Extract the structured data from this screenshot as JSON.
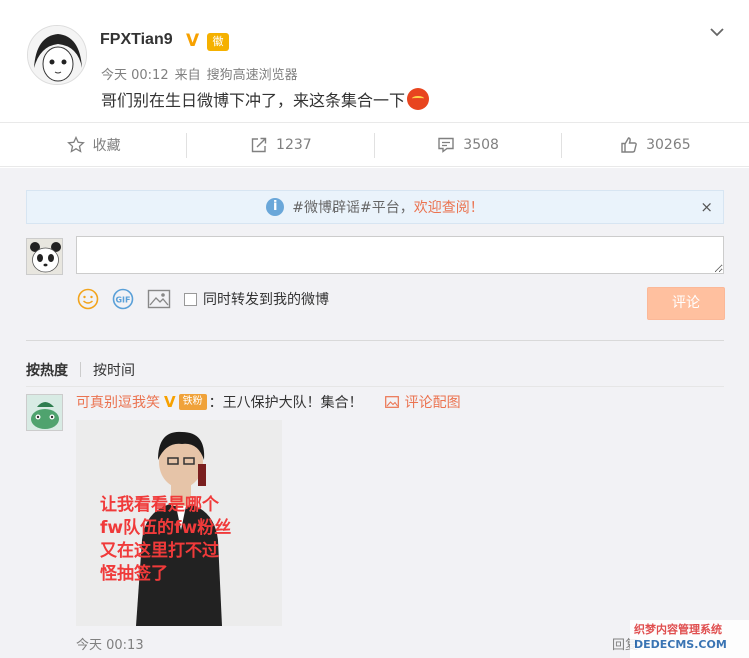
{
  "post": {
    "username": "FPXTian9",
    "verified_badge": "V",
    "medal": "徽",
    "time": "今天 00:12",
    "source_prefix": "来自",
    "source": "搜狗高速浏览器",
    "text": "哥们别在生日微博下冲了，来这条集合一下"
  },
  "actions": {
    "favorite_label": "收藏",
    "repost_count": "1237",
    "comment_count": "3508",
    "like_count": "30265"
  },
  "notice": {
    "text": "#微博辟谣#平台，",
    "link": "欢迎查阅！",
    "close": "×"
  },
  "composer": {
    "placeholder": "",
    "forward_label": "同时转发到我的微博",
    "submit_label": "评论"
  },
  "sort": {
    "hot": "按热度",
    "time": "按时间"
  },
  "comment": {
    "user": "可真别逗我笑",
    "verified_badge": "V",
    "fan_badge": "铁粉",
    "text": "：王八保护大队！集合！",
    "pic_link": "评论配图",
    "image_caption_lines": [
      "让我看看是哪个",
      "fw队伍的fw粉丝",
      "又在这里打不过",
      "怪抽签了"
    ],
    "time": "今天 00:13",
    "reply": "回复"
  },
  "watermark": {
    "line1": "织梦内容管理系统",
    "line2": "DEDECMS.COM"
  },
  "colors": {
    "accent": "#eb7350",
    "verified": "#f7a100",
    "background": "#f2f2f5"
  }
}
